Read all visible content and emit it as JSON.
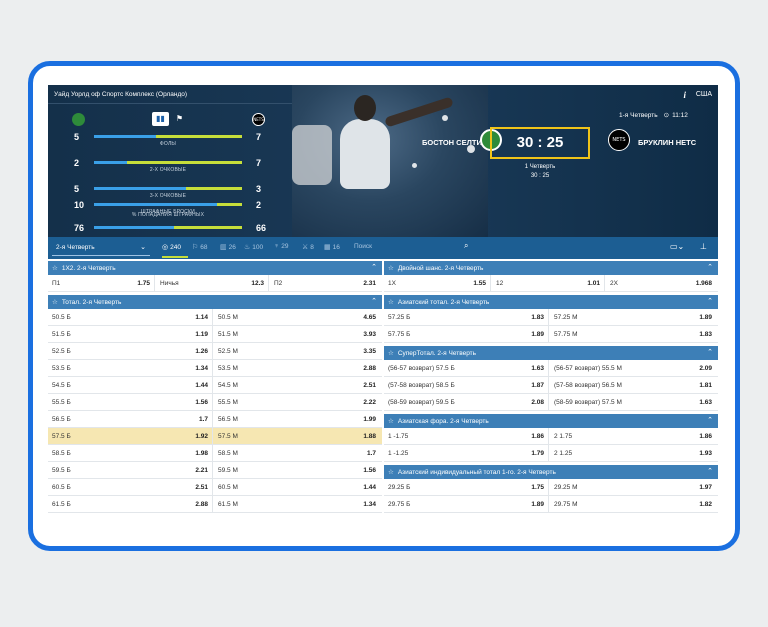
{
  "header": {
    "venue": "Уайд Уорлд оф Спортс Комплекс (Орландо)",
    "country": "США",
    "info_icon": "info-icon",
    "stats": [
      {
        "label": "ФОЛЫ",
        "left": "5",
        "right": "7",
        "left_share": 0.42
      },
      {
        "label": "2-Х ОЧКОВЫЕ",
        "left": "2",
        "right": "7",
        "left_share": 0.22
      },
      {
        "label": "3-Х ОЧКОВЫЕ",
        "left": "5",
        "right": "3",
        "left_share": 0.62
      },
      {
        "label": "ШТРАФНЫЕ БРОСКИ",
        "left": "10",
        "right": "2",
        "left_share": 0.83
      },
      {
        "label": "% ПОПАДАНИЯ ШТРАФНЫХ",
        "left": "76",
        "right": "66",
        "left_share": 0.54
      }
    ],
    "home_logo_text": "NETS",
    "scoreboard": {
      "quarter": "1-я Четверть",
      "clock": "11:12",
      "score": "30 : 25",
      "home": "БОСТОН СЕЛТИКС",
      "away": "БРУКЛИН НЕТС",
      "period_label": "1 Четверть",
      "period_score": "30 : 25",
      "away_logo_text": "NETS"
    }
  },
  "filters": {
    "period": "2-я Четверть",
    "items": [
      {
        "icon": "target-icon",
        "glyph": "◎",
        "count": "240",
        "active": true
      },
      {
        "icon": "court-icon",
        "glyph": "⚐",
        "count": "68",
        "active": false
      },
      {
        "icon": "chart-icon",
        "glyph": "▥",
        "count": "26",
        "active": false
      },
      {
        "icon": "fire-icon",
        "glyph": "♨",
        "count": "100",
        "active": false
      },
      {
        "icon": "cup-icon",
        "glyph": "♆",
        "count": "29",
        "active": false
      },
      {
        "icon": "sword-icon",
        "glyph": "⚔",
        "count": "8",
        "active": false
      },
      {
        "icon": "board-icon",
        "glyph": "▦",
        "count": "16",
        "active": false
      }
    ],
    "search_placeholder": "Поиск"
  },
  "markets": {
    "m1x2": {
      "title": "1X2. 2-я Четверть",
      "cells": [
        {
          "name": "П1",
          "odd": "1.75"
        },
        {
          "name": "Ничья",
          "odd": "12.3"
        },
        {
          "name": "П2",
          "odd": "2.31"
        }
      ]
    },
    "total": {
      "title": "Тотал. 2-я Четверть",
      "rows": [
        {
          "over": "50.5 Б",
          "over_odd": "1.14",
          "under": "50.5 М",
          "under_odd": "4.65"
        },
        {
          "over": "51.5 Б",
          "over_odd": "1.19",
          "under": "51.5 М",
          "under_odd": "3.93"
        },
        {
          "over": "52.5 Б",
          "over_odd": "1.26",
          "under": "52.5 М",
          "under_odd": "3.35"
        },
        {
          "over": "53.5 Б",
          "over_odd": "1.34",
          "under": "53.5 М",
          "under_odd": "2.88"
        },
        {
          "over": "54.5 Б",
          "over_odd": "1.44",
          "under": "54.5 М",
          "under_odd": "2.51"
        },
        {
          "over": "55.5 Б",
          "over_odd": "1.56",
          "under": "55.5 М",
          "under_odd": "2.22"
        },
        {
          "over": "56.5 Б",
          "over_odd": "1.7",
          "under": "56.5 М",
          "under_odd": "1.99"
        },
        {
          "over": "57.5 Б",
          "over_odd": "1.92",
          "under": "57.5 М",
          "under_odd": "1.88"
        },
        {
          "over": "58.5 Б",
          "over_odd": "1.98",
          "under": "58.5 М",
          "under_odd": "1.7"
        },
        {
          "over": "59.5 Б",
          "over_odd": "2.21",
          "under": "59.5 М",
          "under_odd": "1.56"
        },
        {
          "over": "60.5 Б",
          "over_odd": "2.51",
          "under": "60.5 М",
          "under_odd": "1.44"
        },
        {
          "over": "61.5 Б",
          "over_odd": "2.88",
          "under": "61.5 М",
          "under_odd": "1.34"
        }
      ]
    },
    "double": {
      "title": "Двойной шанс. 2-я Четверть",
      "cells": [
        {
          "name": "1X",
          "odd": "1.55"
        },
        {
          "name": "12",
          "odd": "1.01"
        },
        {
          "name": "2X",
          "odd": "1.968"
        }
      ]
    },
    "asian_total": {
      "title": "Азиатский тотал. 2-я Четверть",
      "rows": [
        {
          "a": "57.25 Б",
          "a_odd": "1.83",
          "b": "57.25 М",
          "b_odd": "1.89"
        },
        {
          "a": "57.75 Б",
          "a_odd": "1.89",
          "b": "57.75 М",
          "b_odd": "1.83"
        }
      ]
    },
    "super_total": {
      "title": "СуперТотал. 2-я Четверть",
      "rows": [
        {
          "a": "(56-57 возврат) 57.5 Б",
          "a_odd": "1.63",
          "b": "(56-57 возврат) 55.5 М",
          "b_odd": "2.09"
        },
        {
          "a": "(57-58 возврат) 58.5 Б",
          "a_odd": "1.87",
          "b": "(57-58 возврат) 56.5 М",
          "b_odd": "1.81"
        },
        {
          "a": "(58-59 возврат) 59.5 Б",
          "a_odd": "2.08",
          "b": "(58-59 возврат) 57.5 М",
          "b_odd": "1.63"
        }
      ]
    },
    "asian_handicap": {
      "title": "Азиатская фора. 2-я Четверть",
      "rows": [
        {
          "a": "1 -1.75",
          "a_odd": "1.86",
          "b": "2 1.75",
          "b_odd": "1.86"
        },
        {
          "a": "1 -1.25",
          "a_odd": "1.79",
          "b": "2 1.25",
          "b_odd": "1.93"
        }
      ]
    },
    "asian_ind_total": {
      "title": "Азиатский индивидуальный тотал 1-го. 2-я Четверть",
      "rows": [
        {
          "a": "29.25 Б",
          "a_odd": "1.75",
          "b": "29.25 М",
          "b_odd": "1.97"
        },
        {
          "a": "29.75 Б",
          "a_odd": "1.89",
          "b": "29.75 М",
          "b_odd": "1.82"
        }
      ]
    }
  },
  "colors": {
    "accent": "#1a6fe0",
    "header_bg": "#14304a",
    "section_bg": "#3d7fb7",
    "highlight": "#f6e7b2",
    "bar_green": "#c6de3a",
    "bar_blue": "#3aa0e8",
    "score_border": "#f0c419"
  }
}
